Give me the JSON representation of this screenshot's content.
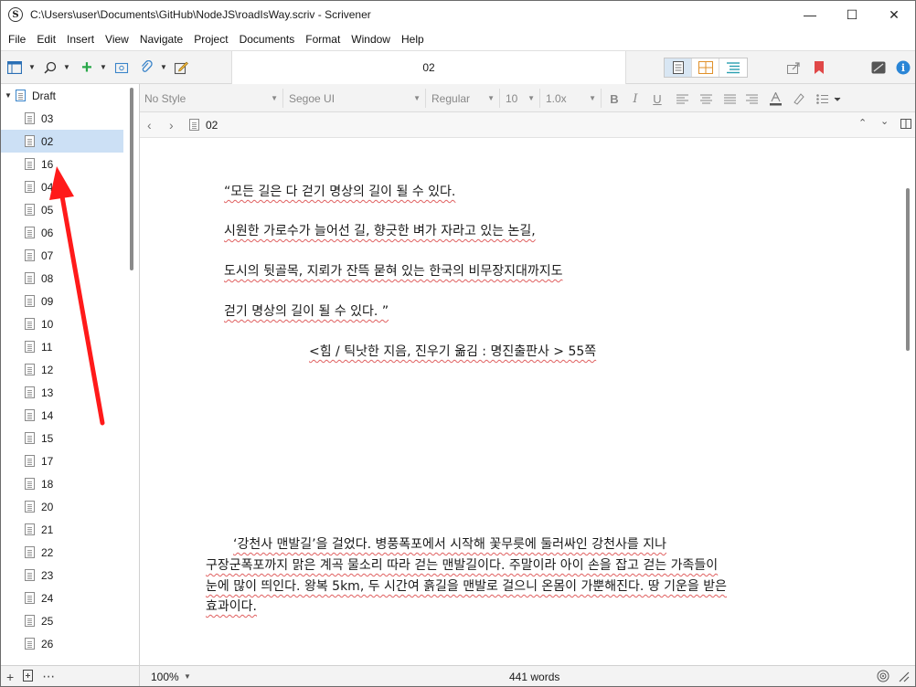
{
  "window": {
    "title": "C:\\Users\\user\\Documents\\GitHub\\NodeJS\\roadIsWay.scriv - Scrivener",
    "minimize": "—",
    "maximize": "☐",
    "close": "✕"
  },
  "menu": [
    "File",
    "Edit",
    "Insert",
    "View",
    "Navigate",
    "Project",
    "Documents",
    "Format",
    "Window",
    "Help"
  ],
  "toolbar": {
    "document_title": "02"
  },
  "binder": {
    "root_label": "Draft",
    "items": [
      "03",
      "02",
      "16",
      "04",
      "05",
      "06",
      "07",
      "08",
      "09",
      "10",
      "11",
      "12",
      "13",
      "14",
      "15",
      "17",
      "18",
      "20",
      "21",
      "22",
      "23",
      "24",
      "25",
      "26"
    ],
    "selected": "02"
  },
  "formatbar": {
    "style": "No Style",
    "font": "Segoe UI",
    "weight": "Regular",
    "size": "10",
    "spacing": "1.0x"
  },
  "header": {
    "doc_name": "02"
  },
  "editor": {
    "lines": [
      "“모든 길은 다 걷기 명상의 길이 될 수 있다.",
      "시원한 가로수가 늘어선 길, 향긋한 벼가 자라고 있는 논길,",
      "도시의 뒷골목, 지뢰가 잔뜩 묻혀 있는 한국의 비무장지대까지도",
      "걷기 명상의 길이 될 수 있다. ”",
      "<힘 / 틱낫한 지음, 진우기 옮김 : 명진출판사 > 55쪽",
      "‘강천사 맨발길’을 걸었다. 병풍폭포에서 시작해 꽃무릇에 둘러싸인 강천사를 지나",
      "구장군폭포까지 맑은 계곡 물소리 따라 걷는 맨발길이다. 주말이라 아이 손을 잡고 걷는 가족들이",
      "눈에 많이 띄인다. 왕복 5km, 두 시간여 흙길을 맨발로 걸으니 온몸이 가뿐해진다. 땅 기운을 받은",
      "효과이다."
    ]
  },
  "statusbar": {
    "zoom": "100%",
    "word_count": "441 words"
  },
  "annotation": {
    "arrow_color": "#ff1a1a"
  }
}
